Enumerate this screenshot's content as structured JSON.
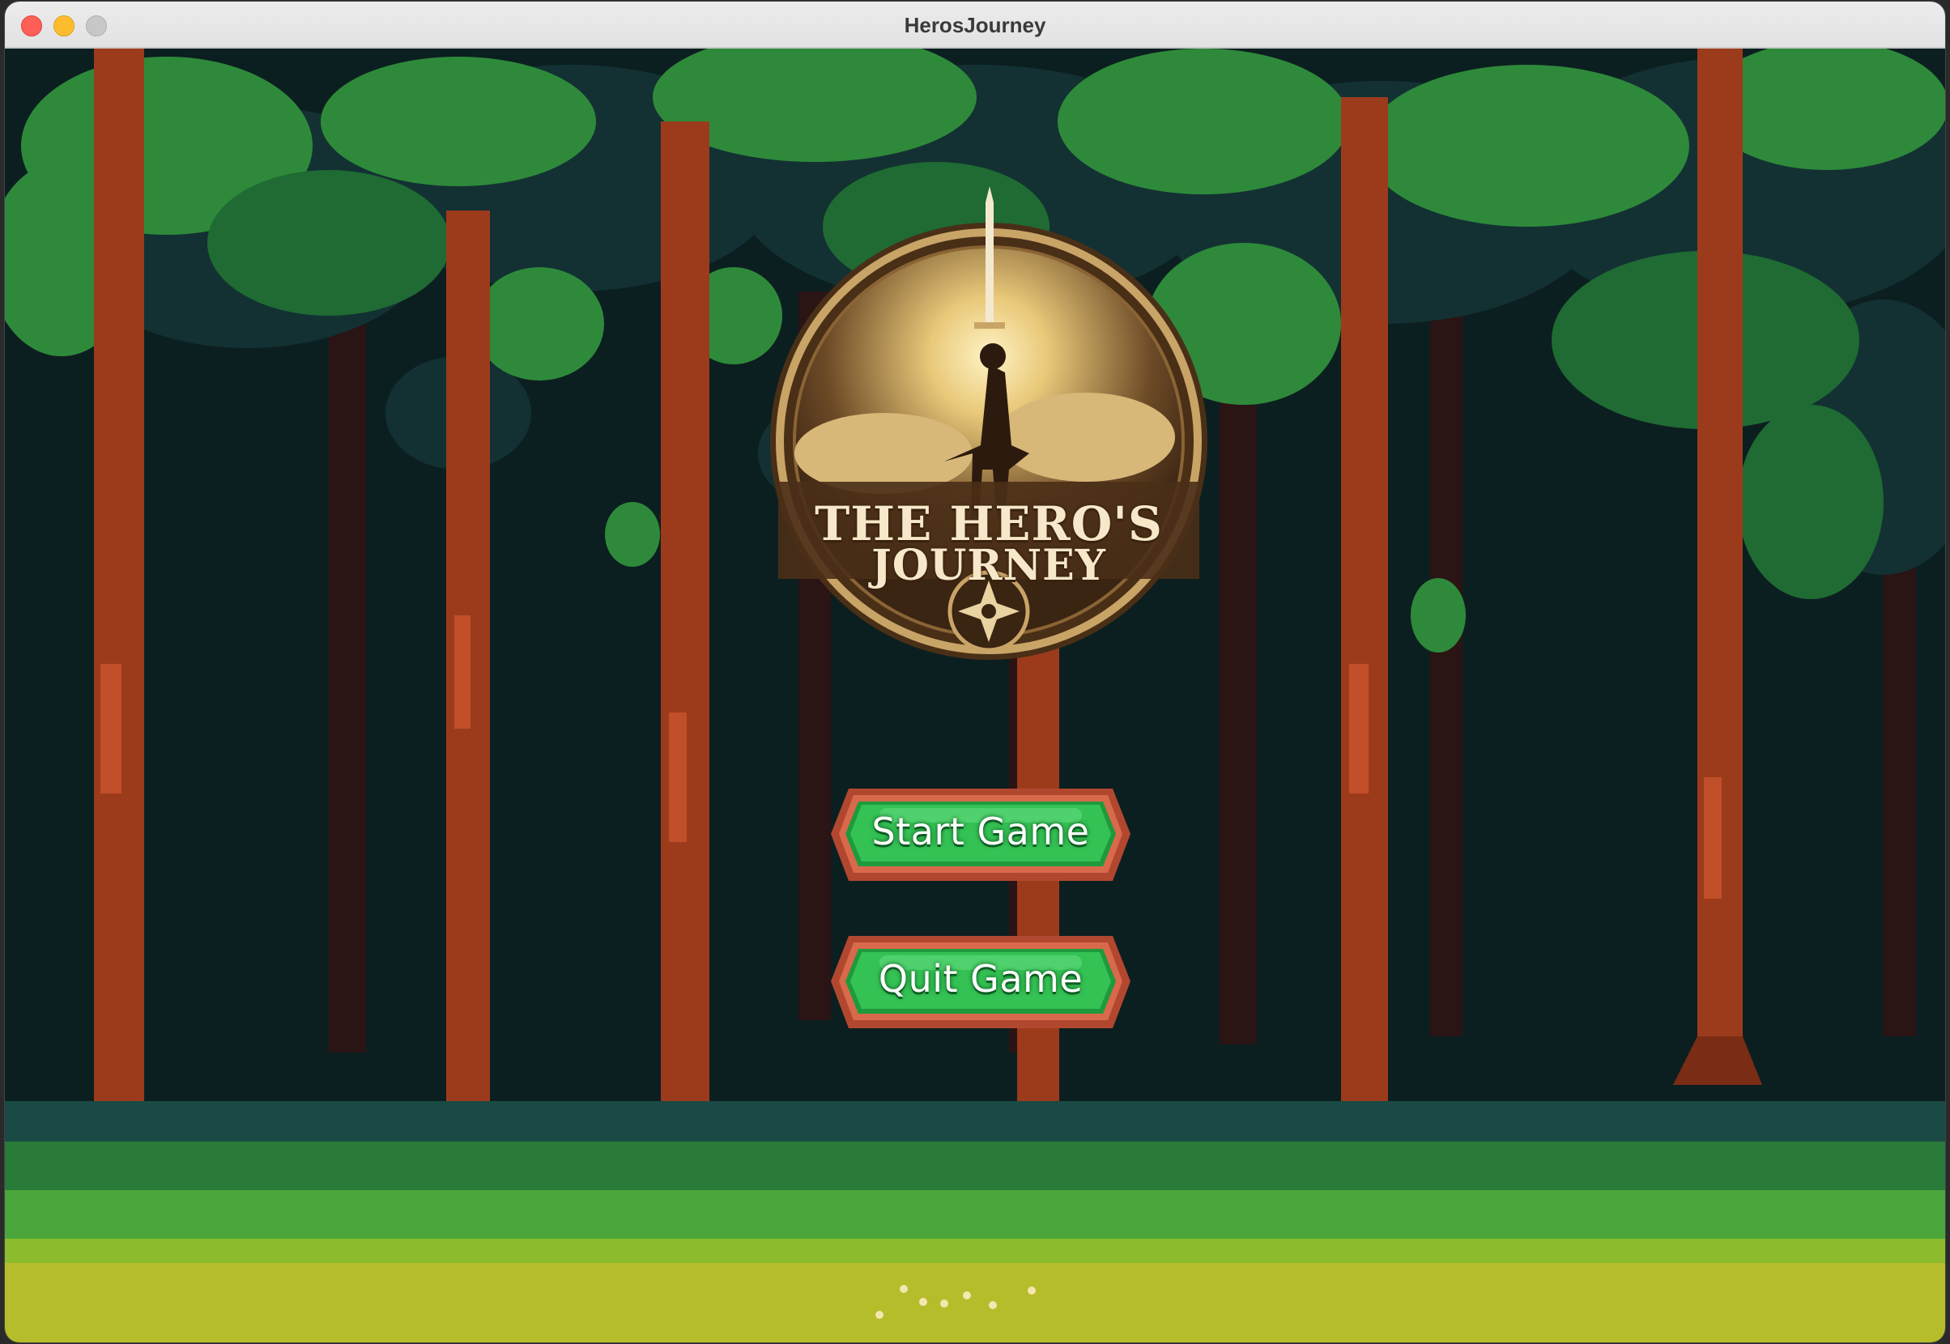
{
  "window": {
    "title": "HerosJourney"
  },
  "logo": {
    "line1": "THE HERO'S",
    "line2": "JOURNEY"
  },
  "menu": {
    "start_label": "Start Game",
    "quit_label": "Quit Game"
  },
  "colors": {
    "button_green": "#2fbf4f",
    "button_frame": "#b2472f",
    "logo_gold": "#c9a467",
    "canopy_green": "#2f8a3a",
    "trunk": "#9c3b1c",
    "meadow": "#b7bf2a"
  },
  "icons": [
    "close-icon",
    "minimize-icon",
    "maximize-icon",
    "sword-emblem-icon",
    "compass-star-icon"
  ]
}
